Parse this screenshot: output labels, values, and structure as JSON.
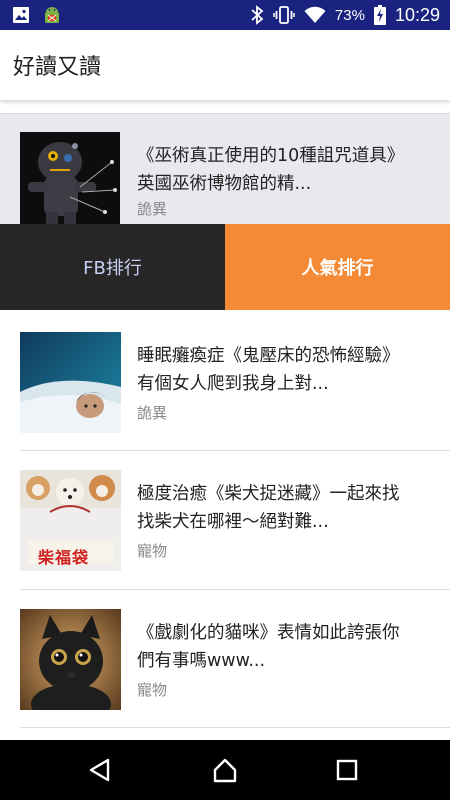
{
  "status_bar": {
    "battery_percent": "73%",
    "time": "10:29",
    "icons": [
      "image-icon",
      "android-debug-icon",
      "bluetooth-icon",
      "vibrate-icon",
      "wifi-icon",
      "battery-charging-icon"
    ],
    "background": "#1a2480"
  },
  "app_bar": {
    "title": "好讀又讀"
  },
  "featured": {
    "title": "《巫術真正使用的10種詛咒道具》英國巫術博物館的精...",
    "category": "詭異",
    "thumbnail": "voodoo-doll-image"
  },
  "tabs": [
    {
      "label": "FB排行",
      "selected": false
    },
    {
      "label": "人氣排行",
      "selected": true,
      "color": "#f48a35"
    }
  ],
  "articles": [
    {
      "title": "睡眠癱瘓症《鬼壓床的恐怖經驗》有個女人爬到我身上對...",
      "category": "詭異",
      "thumbnail": "sleeping-woman-image"
    },
    {
      "title": "極度治癒《柴犬捉迷藏》一起來找找柴犬在哪裡～絕對難...",
      "category": "寵物",
      "thumbnail": "shiba-lucky-bag-image",
      "thumb_caption": "柴福袋"
    },
    {
      "title": "《戲劇化的貓咪》表情如此誇張你們有事嗎www...",
      "category": "寵物",
      "thumbnail": "black-cat-image"
    }
  ],
  "nav_bar": {
    "buttons": [
      "back-icon",
      "home-icon",
      "recents-icon"
    ]
  }
}
